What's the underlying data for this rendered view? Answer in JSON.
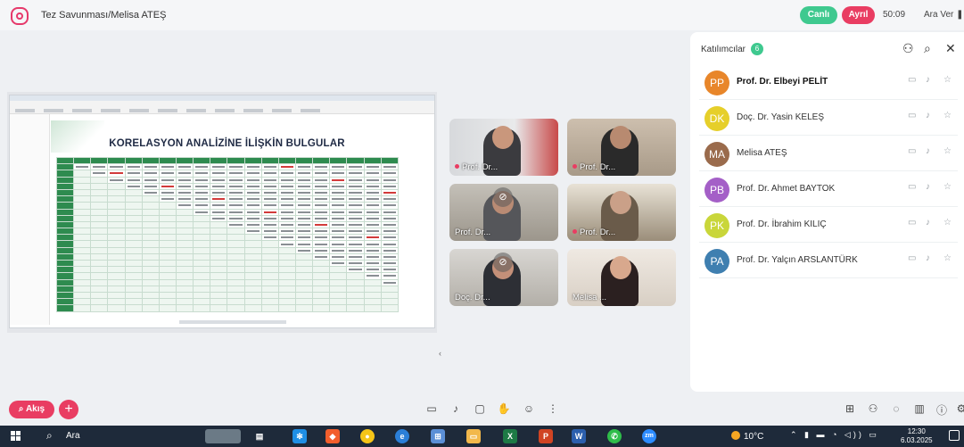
{
  "meeting": {
    "title": "Tez Savunması/Melisa ATEŞ",
    "live_label": "Canlı",
    "leave_label": "Ayrıl",
    "timer": "50:09",
    "break_label": "Ara Ver"
  },
  "shared_screen": {
    "slide_title": "KORELASYON ANALİZİNE İLİŞKİN BULGULAR"
  },
  "video_tiles": [
    {
      "name": "Prof. Dr...",
      "muted": false,
      "active": true
    },
    {
      "name": "Prof. Dr...",
      "muted": false,
      "active": true
    },
    {
      "name": "Prof. Dr...",
      "muted": true,
      "active": false
    },
    {
      "name": "Prof. Dr...",
      "muted": false,
      "active": true
    },
    {
      "name": "Doç. Dr...",
      "muted": true,
      "active": false
    },
    {
      "name": "Melisa ...",
      "muted": false,
      "active": false
    }
  ],
  "participants_panel": {
    "title": "Katılımcılar",
    "count": "6",
    "participants": [
      {
        "initials": "PP",
        "name": "Prof. Dr. Elbeyi PELİT",
        "color": "#e8862a",
        "bold": true
      },
      {
        "initials": "DK",
        "name": "Doç. Dr. Yasin KELEŞ",
        "color": "#e6cf2a",
        "bold": false
      },
      {
        "initials": "MA",
        "name": "Melisa ATEŞ",
        "color": "#9a6b4c",
        "bold": false
      },
      {
        "initials": "PB",
        "name": "Prof. Dr. Ahmet BAYTOK",
        "color": "#a45fc7",
        "bold": false
      },
      {
        "initials": "PK",
        "name": "Prof. Dr. İbrahim KILIÇ",
        "color": "#c9d63a",
        "bold": false
      },
      {
        "initials": "PA",
        "name": "Prof. Dr. Yalçın ARSLANTÜRK",
        "color": "#3f7fb0",
        "bold": false
      }
    ]
  },
  "bottom_bar": {
    "flow_label": "Akış"
  },
  "taskbar": {
    "search_label": "Ara",
    "weather": "10°C",
    "time": "12:30",
    "date": "6.03.2025"
  }
}
